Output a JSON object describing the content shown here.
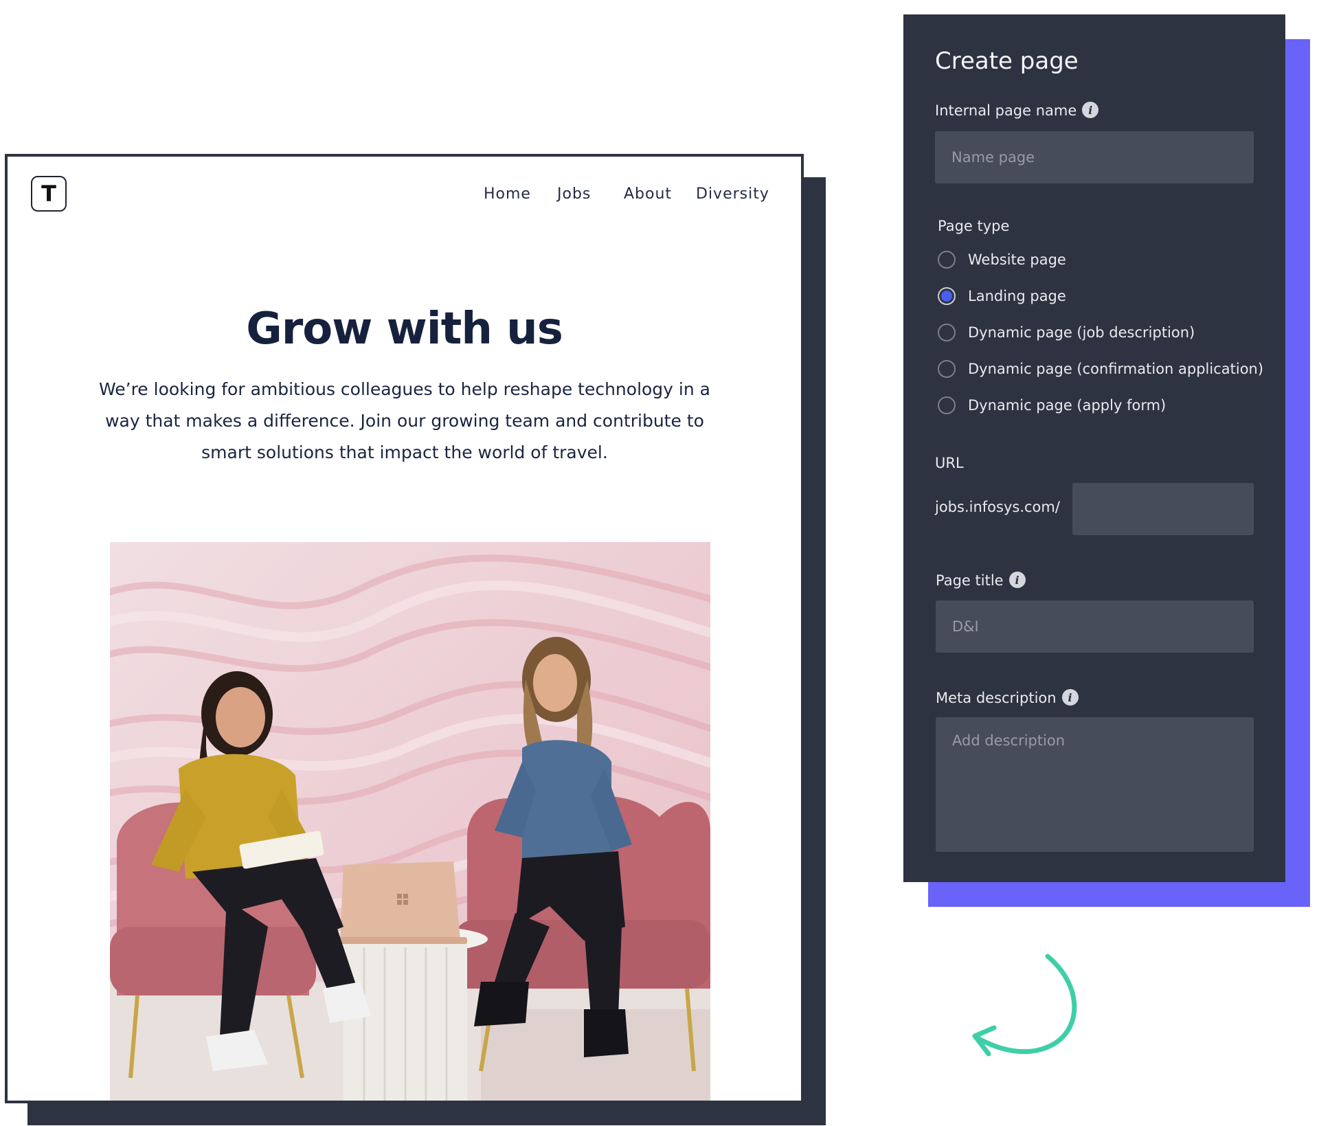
{
  "website": {
    "logo_letter": "T",
    "nav": [
      "Home",
      "Jobs",
      "About",
      "Diversity"
    ],
    "hero_title": "Grow with us",
    "hero_text": "We’re looking for ambitious colleagues to help reshape technology in a way that makes a difference. Join our growing team and contribute to smart solutions that impact the world of travel."
  },
  "panel": {
    "title": "Create page",
    "internal_name_label": "Internal page name",
    "internal_name_placeholder": "Name page",
    "page_type_label": "Page type",
    "page_types": [
      {
        "label": "Website page",
        "selected": false
      },
      {
        "label": "Landing page",
        "selected": true
      },
      {
        "label": "Dynamic page (job description)",
        "selected": false
      },
      {
        "label": "Dynamic page (confirmation application)",
        "selected": false
      },
      {
        "label": "Dynamic page (apply form)",
        "selected": false
      }
    ],
    "url_label": "URL",
    "url_prefix": "jobs.infosys.com/",
    "page_title_label": "Page title",
    "page_title_placeholder": "D&I",
    "meta_label": "Meta description",
    "meta_placeholder": "Add description"
  },
  "colors": {
    "panel_bg": "#2e3341",
    "accent_purple": "#6a63fa",
    "radio_selected": "#4a5ef0",
    "arrow": "#3ecfa8"
  },
  "icons": [
    "info-icon",
    "curved-arrow-icon"
  ]
}
